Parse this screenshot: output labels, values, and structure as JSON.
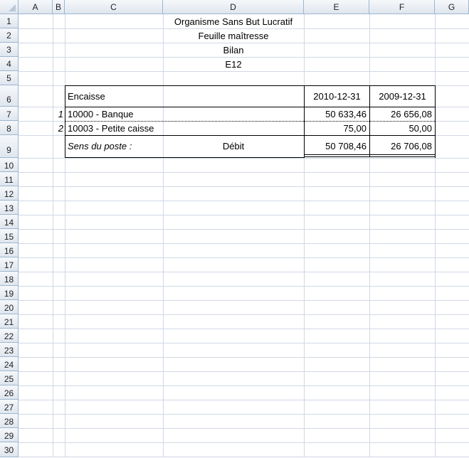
{
  "columns": [
    "A",
    "B",
    "C",
    "D",
    "E",
    "F",
    "G"
  ],
  "rows": [
    "1",
    "2",
    "3",
    "4",
    "5",
    "6",
    "7",
    "8",
    "9",
    "10",
    "11",
    "12",
    "13",
    "14",
    "15",
    "16",
    "17",
    "18",
    "19",
    "20",
    "21",
    "22",
    "23",
    "24",
    "25",
    "26",
    "27",
    "28",
    "29",
    "30"
  ],
  "titles": {
    "org": "Organisme Sans But Lucratif",
    "sheet": "Feuille maîtresse",
    "report": "Bilan",
    "ref": "E12"
  },
  "table": {
    "header": {
      "label": "Encaisse",
      "col_e": "2010-12-31",
      "col_f": "2009-12-31"
    },
    "rows": [
      {
        "num": "1",
        "account": "10000 - Banque",
        "e": "50 633,46",
        "f": "26 656,08"
      },
      {
        "num": "2",
        "account": "10003 - Petite caisse",
        "e": "75,00",
        "f": "50,00"
      }
    ],
    "total": {
      "label": "Sens du poste :",
      "sens": "Débit",
      "e": "50 708,46",
      "f": "26 706,08"
    }
  }
}
